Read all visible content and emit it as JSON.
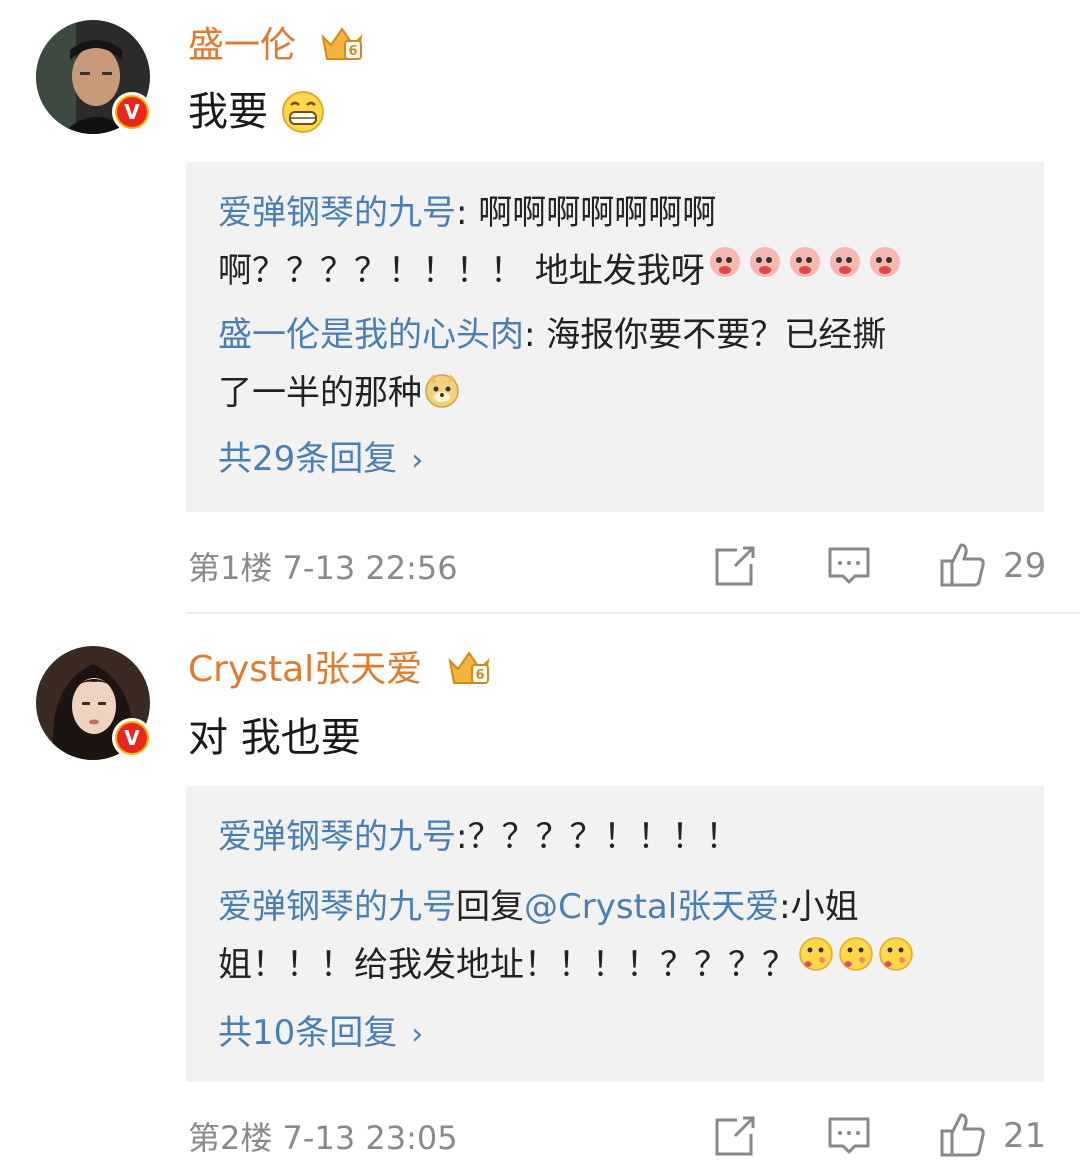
{
  "comments": [
    {
      "username": "盛一伦",
      "vip_icon": "vip-crown-icon",
      "text": "我要",
      "text_emoji": "grin-emoji",
      "replies": [
        {
          "user": "爱弹钢琴的九号",
          "sep": ": ",
          "text_line1": "啊啊啊啊啊啊啊",
          "text_line2": "啊？？？？！！！！ 地址发我呀",
          "emojis": [
            "pig-emoji",
            "pig-emoji",
            "pig-emoji",
            "pig-emoji",
            "pig-emoji"
          ]
        },
        {
          "user": "盛一伦是我的心头肉",
          "sep": ": ",
          "text_line1": "海报你要不要？已经撕",
          "text_line2": "了一半的那种",
          "emojis": [
            "doge-emoji"
          ]
        }
      ],
      "more_replies": "共29条回复",
      "floor": "第1楼",
      "time": "7-13 22:56",
      "likes": "29"
    },
    {
      "username": "Crystal张天爱",
      "vip_icon": "vip-crown-icon",
      "text": "对 我也要",
      "replies": [
        {
          "user": "爱弹钢琴的九号",
          "sep": ":",
          "text_line1": "？？？？！！！！",
          "text_line2": ""
        },
        {
          "user": "爱弹钢琴的九号",
          "reply_word": "回复",
          "mention": "@Crystal张天爱",
          "sep": ":",
          "text_line1": "小姐",
          "text_line2": "姐！！！给我发地址！！！！？？？？",
          "emojis": [
            "kiss-emoji",
            "kiss-emoji",
            "kiss-emoji"
          ]
        }
      ],
      "more_replies": "共10条回复",
      "floor": "第2楼",
      "time": "7-13 23:05",
      "likes": "21"
    }
  ],
  "colors": {
    "username": "#e07a2e",
    "reply_user": "#4a7fb5",
    "meta": "#8a8a8a",
    "reply_bg": "#f2f2f2",
    "badge_red": "#e8281c",
    "badge_gold": "#f7b500"
  }
}
